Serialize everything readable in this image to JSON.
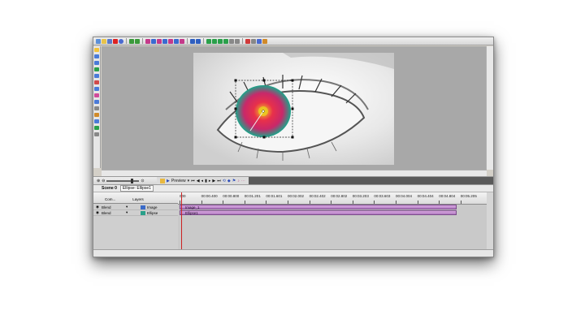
{
  "transport": {
    "preview_label": "Preview"
  },
  "tabs": [
    {
      "label": "Scene 0"
    },
    {
      "label": "Ellipse: Ellipse1"
    }
  ],
  "timeline": {
    "header": {
      "com_label": "Com...",
      "layers_label": "Layers"
    },
    "ruler_ticks": [
      "000",
      "00:00.400",
      "00:00.800",
      "00:01.201",
      "00:01.601",
      "00:02.002",
      "00:02.402",
      "00:02.802",
      "00:03.203",
      "00:03.603",
      "00:04.004",
      "00:04.404",
      "00:04.804",
      "00:05.205"
    ],
    "tracks": [
      {
        "blend": "Blend",
        "name": "Image",
        "clip": "Image_1",
        "icon": "image-layer-icon"
      },
      {
        "blend": "Blend",
        "name": "Ellipse",
        "clip": "Ellipse1",
        "icon": "ellipse-layer-icon"
      }
    ]
  },
  "colors": {
    "gradient_inner": "#f2d020",
    "gradient_mid": "#e8304a",
    "gradient_outer": "#1aa58a",
    "clip_fill": "#c08ad0",
    "playhead": "#cc2222"
  }
}
